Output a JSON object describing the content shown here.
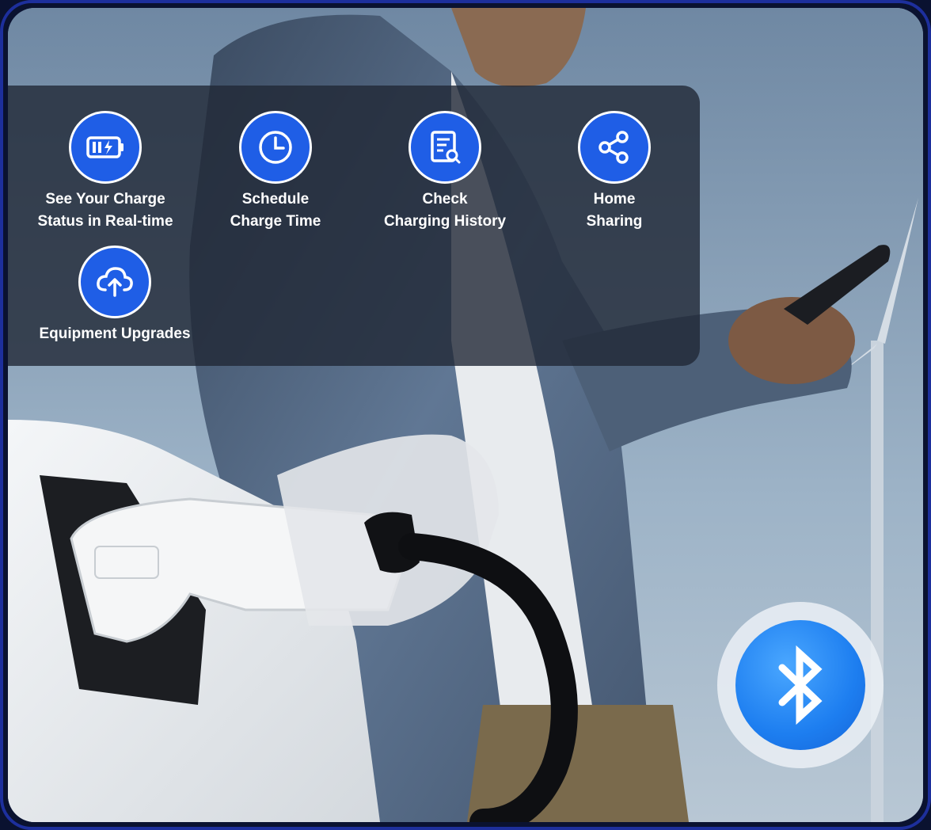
{
  "features": [
    {
      "icon": "battery-charging-icon",
      "label": "See Your Charge\nStatus in Real-time"
    },
    {
      "icon": "clock-icon",
      "label": "Schedule\nCharge Time"
    },
    {
      "icon": "document-search-icon",
      "label": "Check\nCharging History"
    },
    {
      "icon": "share-icon",
      "label": "Home\nSharing"
    },
    {
      "icon": "cloud-upload-icon",
      "label": "Equipment Upgrades"
    }
  ],
  "badge": {
    "icon": "bluetooth-icon"
  },
  "colors": {
    "accent": "#1f5ee6",
    "bluetooth": "#1d7ef0",
    "panel": "#202836"
  }
}
